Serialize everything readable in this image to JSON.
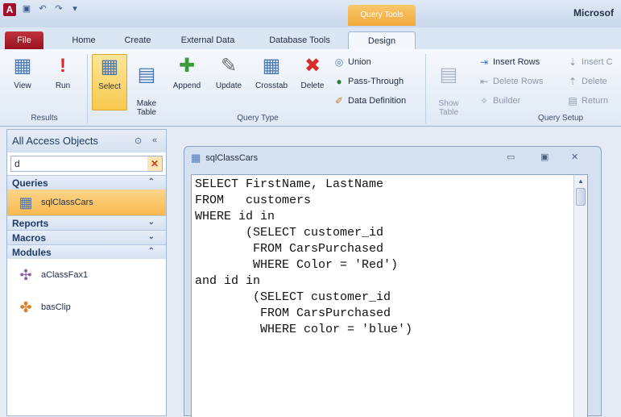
{
  "window": {
    "app_icon": "A",
    "context_tab": "Query Tools",
    "app_title": "Microsof"
  },
  "tabs": {
    "file": "File",
    "home": "Home",
    "create": "Create",
    "external": "External Data",
    "dbtools": "Database Tools",
    "design": "Design"
  },
  "ribbon": {
    "results": {
      "view": "View",
      "run": "Run",
      "label": "Results"
    },
    "query_type": {
      "select": "Select",
      "make_table": "Make\nTable",
      "append": "Append",
      "update": "Update",
      "crosstab": "Crosstab",
      "delete": "Delete",
      "union": "Union",
      "passthrough": "Pass-Through",
      "data_definition": "Data Definition",
      "label": "Query Type"
    },
    "query_setup": {
      "show_table": "Show\nTable",
      "insert_rows": "Insert Rows",
      "delete_rows": "Delete Rows",
      "builder": "Builder",
      "insert_col": "Insert C",
      "delete_col": "Delete",
      "return": "Return",
      "label": "Query Setup"
    }
  },
  "nav": {
    "title": "All Access Objects",
    "search_value": "d",
    "categories": {
      "queries": "Queries",
      "reports": "Reports",
      "macros": "Macros",
      "modules": "Modules"
    },
    "queries": [
      "sqlClassCars"
    ],
    "modules": [
      "aClassFax1",
      "basClip"
    ]
  },
  "document": {
    "title": "sqlClassCars",
    "sql_lines": [
      "SELECT FirstName, LastName",
      "FROM   customers",
      "WHERE id in",
      "       (SELECT customer_id",
      "        FROM CarsPurchased",
      "        WHERE Color = 'Red')",
      "and id in",
      "        (SELECT customer_id",
      "         FROM CarsPurchased",
      "         WHERE color = 'blue')"
    ]
  },
  "colors": {
    "accent": "#f7c94f",
    "file_tab": "#97121f",
    "context_tab": "#f3a83b"
  }
}
